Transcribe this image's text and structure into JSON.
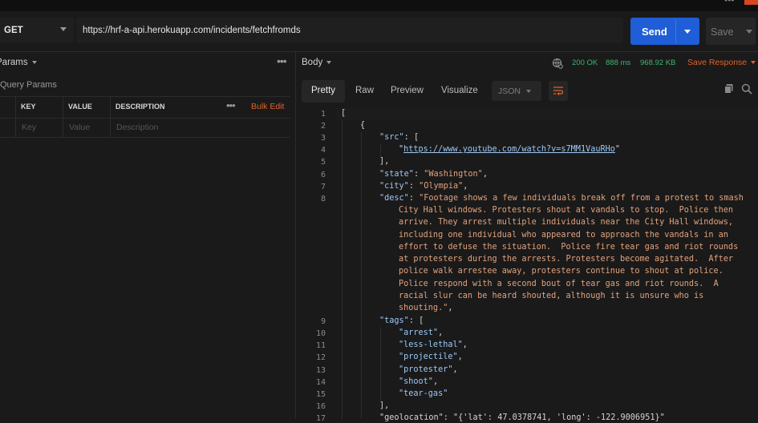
{
  "window": {
    "title": ""
  },
  "request": {
    "method": "GET",
    "url": "https://hrf-a-api.herokuapp.com/incidents/fetchfromds",
    "send_label": "Send",
    "save_label": "Save"
  },
  "params": {
    "title": "Params",
    "section": "Query Params",
    "columns": [
      "KEY",
      "VALUE",
      "DESCRIPTION"
    ],
    "bulk_edit": "Bulk Edit",
    "placeholders": {
      "key": "Key",
      "value": "Value",
      "description": "Description"
    }
  },
  "response": {
    "body_label": "Body",
    "status": "200 OK",
    "time": "888 ms",
    "size": "968.92 KB",
    "save_response": "Save Response",
    "tabs": [
      "Pretty",
      "Raw",
      "Preview",
      "Visualize"
    ],
    "active_tab": "Pretty",
    "format": "JSON"
  },
  "code": {
    "line_numbers": [
      "1",
      "2",
      "3",
      "4",
      "5",
      "6",
      "7",
      "8",
      "9",
      "10",
      "11",
      "12",
      "13",
      "14",
      "15",
      "16",
      "17"
    ],
    "src_url": "https://www.youtube.com/watch?v=s7MM1VauRHo",
    "state": "\"Washington\"",
    "city": "\"Olympia\"",
    "desc_lines": [
      "\"Footage shows a few individuals break off from a protest to smash",
      "City Hall windows. Protesters shout at vandals to stop.  Police then",
      "arrive. They arrest multiple individuals near the City Hall windows,",
      "including one individual who appeared to approach the vandals in an",
      "effort to defuse the situation.  Police fire tear gas and riot rounds",
      "at protesters during the arrests. Protesters become agitated.  After",
      "police walk arrestee away, protesters continue to shout at police.",
      "Police respond with a second bout of tear gas and riot rounds.  A",
      "racial slur can be heard shouted, although it is unsure who is",
      "shouting.\""
    ],
    "tags": [
      "\"arrest\"",
      "\"less-lethal\"",
      "\"projectile\"",
      "\"protester\"",
      "\"shoot\"",
      "\"tear-gas\""
    ],
    "line17": "\"geolocation\": \"{'lat': 47.0378741, 'long': -122.9006951}\""
  },
  "colors": {
    "accent": "#1f5ed6",
    "orange": "#e0622c",
    "success": "#3fb56f",
    "json_key": "#9cc8f5",
    "json_string": "#e3a27c"
  }
}
